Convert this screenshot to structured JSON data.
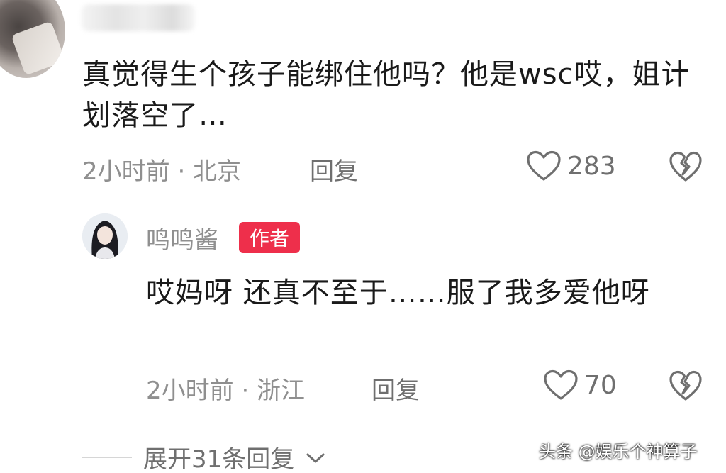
{
  "comment": {
    "text": "真觉得生个孩子能绑住他吗？他是wsc哎，姐计划落空了…",
    "meta": "2小时前 · 北京",
    "reply_label": "回复",
    "like_count": "283",
    "icons": [
      "heart-icon",
      "broken-heart-icon"
    ]
  },
  "reply": {
    "author": "鸣鸣酱",
    "author_badge": "作者",
    "text": "哎妈呀 还真不至于……服了我多爱他呀",
    "meta": "2小时前 · 浙江",
    "reply_label": "回复",
    "like_count": "70",
    "badge_color": "#ee2f4b"
  },
  "expand_label": "展开31条回复",
  "watermark": "头条 @娱乐个神算子"
}
